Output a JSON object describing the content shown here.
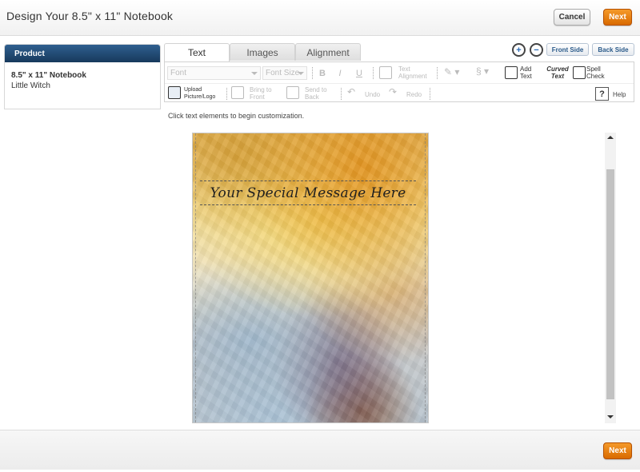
{
  "header": {
    "title": "Design Your 8.5\" x 11\" Notebook",
    "cancel_label": "Cancel",
    "next_label": "Next"
  },
  "product": {
    "heading": "Product",
    "name": "8.5\" x 11\" Notebook",
    "design": "Little Witch"
  },
  "tabs": [
    {
      "label": "Text",
      "active": true
    },
    {
      "label": "Images",
      "active": false
    },
    {
      "label": "Alignment",
      "active": false
    }
  ],
  "view": {
    "front_label": "Front Side",
    "back_label": "Back Side",
    "zoom_in_icon": "zoom-in-icon",
    "zoom_out_icon": "zoom-out-icon"
  },
  "toolbar": {
    "font_placeholder": "Font",
    "font_size_placeholder": "Font Size",
    "bold": "B",
    "italic": "I",
    "underline": "U",
    "text_alignment": "Text Alignment",
    "add_text": "Add Text",
    "curved_text": "Curved Text",
    "spell_check": "Spell Check",
    "upload": "Upload Picture/Logo",
    "bring_front": "Bring to Front",
    "send_back": "Send to Back",
    "undo": "Undo",
    "redo": "Redo",
    "help": "Help"
  },
  "hint": "Click text elements to begin customization.",
  "canvas": {
    "message": "Your Special Message Here"
  },
  "footer": {
    "next_label": "Next"
  },
  "colors": {
    "accent_orange": "#e07a10",
    "panel_blue": "#1f4a75",
    "side_button_text": "#2a5a8a"
  }
}
